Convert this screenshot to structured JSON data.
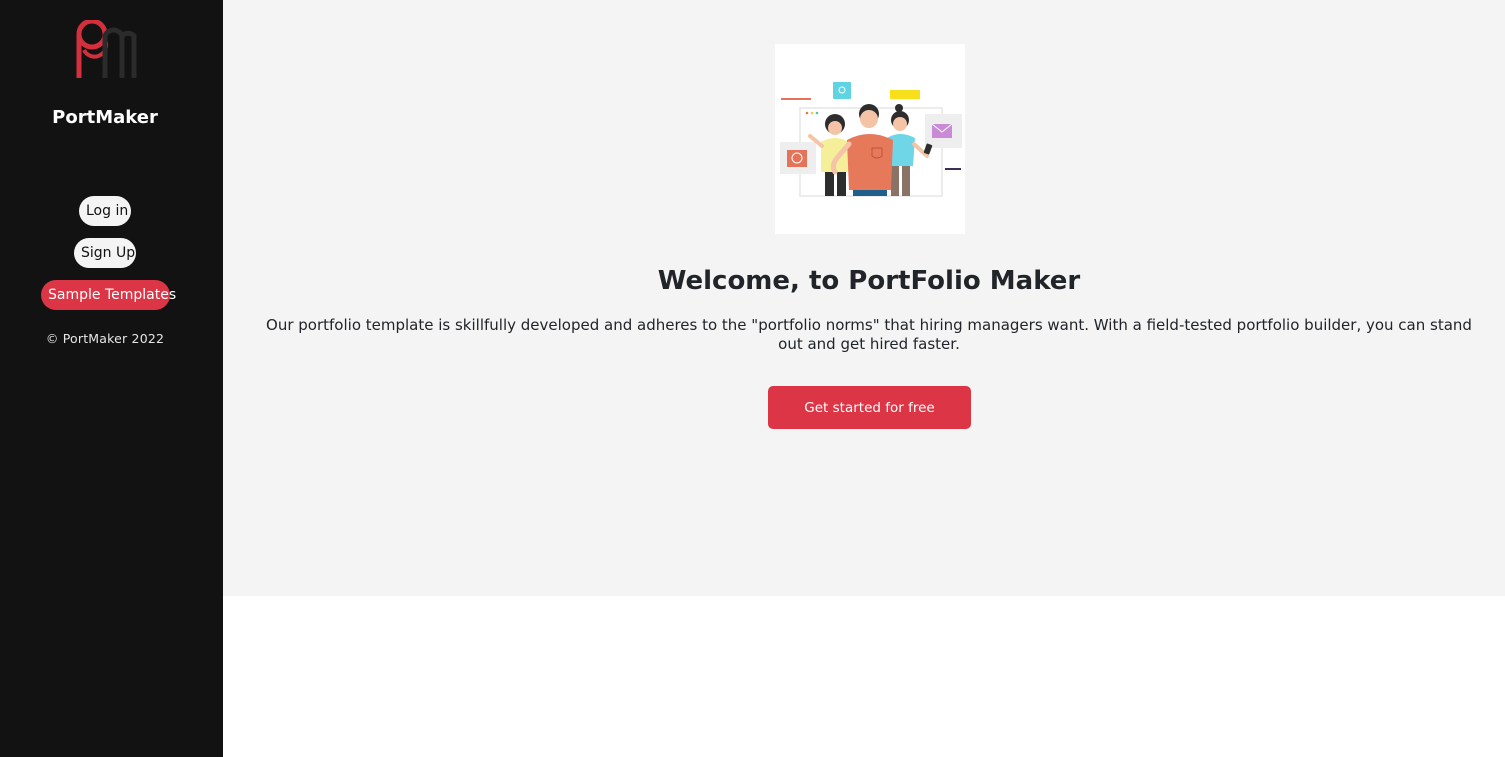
{
  "sidebar": {
    "brand": "PortMaker",
    "nav": {
      "login": "Log in",
      "signup": "Sign Up",
      "templates": "Sample Templates"
    },
    "copyright": "© PortMaker 2022"
  },
  "hero": {
    "title": "Welcome, to PortFolio Maker",
    "description": "Our portfolio template is skillfully developed and adheres to the \"portfolio norms\" that hiring managers want. With a field-tested portfolio builder, you can stand out and get hired faster.",
    "cta": "Get started for free"
  },
  "colors": {
    "sidebar_bg": "#121212",
    "accent": "#dc3545",
    "main_bg": "#f4f4f4"
  }
}
